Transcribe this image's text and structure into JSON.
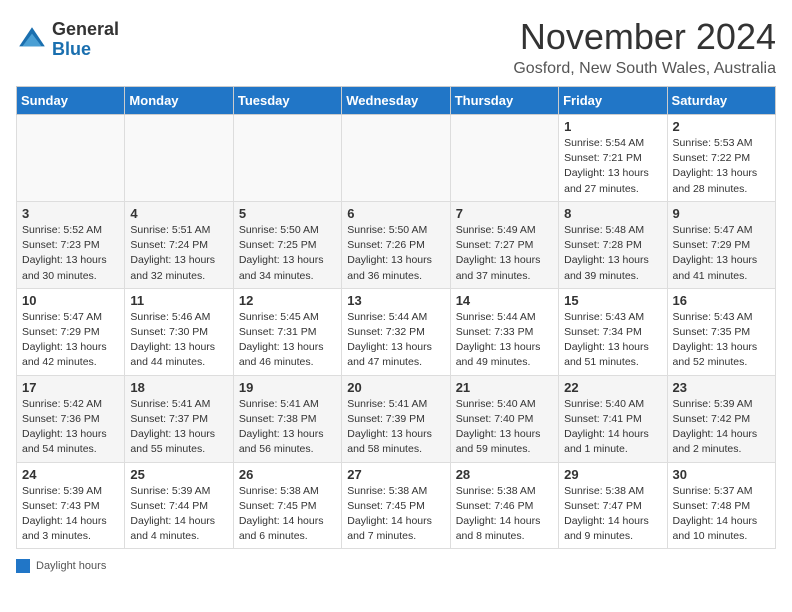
{
  "header": {
    "logo_general": "General",
    "logo_blue": "Blue",
    "title": "November 2024",
    "subtitle": "Gosford, New South Wales, Australia"
  },
  "days_of_week": [
    "Sunday",
    "Monday",
    "Tuesday",
    "Wednesday",
    "Thursday",
    "Friday",
    "Saturday"
  ],
  "weeks": [
    [
      {
        "day": "",
        "info": ""
      },
      {
        "day": "",
        "info": ""
      },
      {
        "day": "",
        "info": ""
      },
      {
        "day": "",
        "info": ""
      },
      {
        "day": "",
        "info": ""
      },
      {
        "day": "1",
        "info": "Sunrise: 5:54 AM\nSunset: 7:21 PM\nDaylight: 13 hours and 27 minutes."
      },
      {
        "day": "2",
        "info": "Sunrise: 5:53 AM\nSunset: 7:22 PM\nDaylight: 13 hours and 28 minutes."
      }
    ],
    [
      {
        "day": "3",
        "info": "Sunrise: 5:52 AM\nSunset: 7:23 PM\nDaylight: 13 hours and 30 minutes."
      },
      {
        "day": "4",
        "info": "Sunrise: 5:51 AM\nSunset: 7:24 PM\nDaylight: 13 hours and 32 minutes."
      },
      {
        "day": "5",
        "info": "Sunrise: 5:50 AM\nSunset: 7:25 PM\nDaylight: 13 hours and 34 minutes."
      },
      {
        "day": "6",
        "info": "Sunrise: 5:50 AM\nSunset: 7:26 PM\nDaylight: 13 hours and 36 minutes."
      },
      {
        "day": "7",
        "info": "Sunrise: 5:49 AM\nSunset: 7:27 PM\nDaylight: 13 hours and 37 minutes."
      },
      {
        "day": "8",
        "info": "Sunrise: 5:48 AM\nSunset: 7:28 PM\nDaylight: 13 hours and 39 minutes."
      },
      {
        "day": "9",
        "info": "Sunrise: 5:47 AM\nSunset: 7:29 PM\nDaylight: 13 hours and 41 minutes."
      }
    ],
    [
      {
        "day": "10",
        "info": "Sunrise: 5:47 AM\nSunset: 7:29 PM\nDaylight: 13 hours and 42 minutes."
      },
      {
        "day": "11",
        "info": "Sunrise: 5:46 AM\nSunset: 7:30 PM\nDaylight: 13 hours and 44 minutes."
      },
      {
        "day": "12",
        "info": "Sunrise: 5:45 AM\nSunset: 7:31 PM\nDaylight: 13 hours and 46 minutes."
      },
      {
        "day": "13",
        "info": "Sunrise: 5:44 AM\nSunset: 7:32 PM\nDaylight: 13 hours and 47 minutes."
      },
      {
        "day": "14",
        "info": "Sunrise: 5:44 AM\nSunset: 7:33 PM\nDaylight: 13 hours and 49 minutes."
      },
      {
        "day": "15",
        "info": "Sunrise: 5:43 AM\nSunset: 7:34 PM\nDaylight: 13 hours and 51 minutes."
      },
      {
        "day": "16",
        "info": "Sunrise: 5:43 AM\nSunset: 7:35 PM\nDaylight: 13 hours and 52 minutes."
      }
    ],
    [
      {
        "day": "17",
        "info": "Sunrise: 5:42 AM\nSunset: 7:36 PM\nDaylight: 13 hours and 54 minutes."
      },
      {
        "day": "18",
        "info": "Sunrise: 5:41 AM\nSunset: 7:37 PM\nDaylight: 13 hours and 55 minutes."
      },
      {
        "day": "19",
        "info": "Sunrise: 5:41 AM\nSunset: 7:38 PM\nDaylight: 13 hours and 56 minutes."
      },
      {
        "day": "20",
        "info": "Sunrise: 5:41 AM\nSunset: 7:39 PM\nDaylight: 13 hours and 58 minutes."
      },
      {
        "day": "21",
        "info": "Sunrise: 5:40 AM\nSunset: 7:40 PM\nDaylight: 13 hours and 59 minutes."
      },
      {
        "day": "22",
        "info": "Sunrise: 5:40 AM\nSunset: 7:41 PM\nDaylight: 14 hours and 1 minute."
      },
      {
        "day": "23",
        "info": "Sunrise: 5:39 AM\nSunset: 7:42 PM\nDaylight: 14 hours and 2 minutes."
      }
    ],
    [
      {
        "day": "24",
        "info": "Sunrise: 5:39 AM\nSunset: 7:43 PM\nDaylight: 14 hours and 3 minutes."
      },
      {
        "day": "25",
        "info": "Sunrise: 5:39 AM\nSunset: 7:44 PM\nDaylight: 14 hours and 4 minutes."
      },
      {
        "day": "26",
        "info": "Sunrise: 5:38 AM\nSunset: 7:45 PM\nDaylight: 14 hours and 6 minutes."
      },
      {
        "day": "27",
        "info": "Sunrise: 5:38 AM\nSunset: 7:45 PM\nDaylight: 14 hours and 7 minutes."
      },
      {
        "day": "28",
        "info": "Sunrise: 5:38 AM\nSunset: 7:46 PM\nDaylight: 14 hours and 8 minutes."
      },
      {
        "day": "29",
        "info": "Sunrise: 5:38 AM\nSunset: 7:47 PM\nDaylight: 14 hours and 9 minutes."
      },
      {
        "day": "30",
        "info": "Sunrise: 5:37 AM\nSunset: 7:48 PM\nDaylight: 14 hours and 10 minutes."
      }
    ]
  ],
  "legend": {
    "label": "Daylight hours"
  }
}
